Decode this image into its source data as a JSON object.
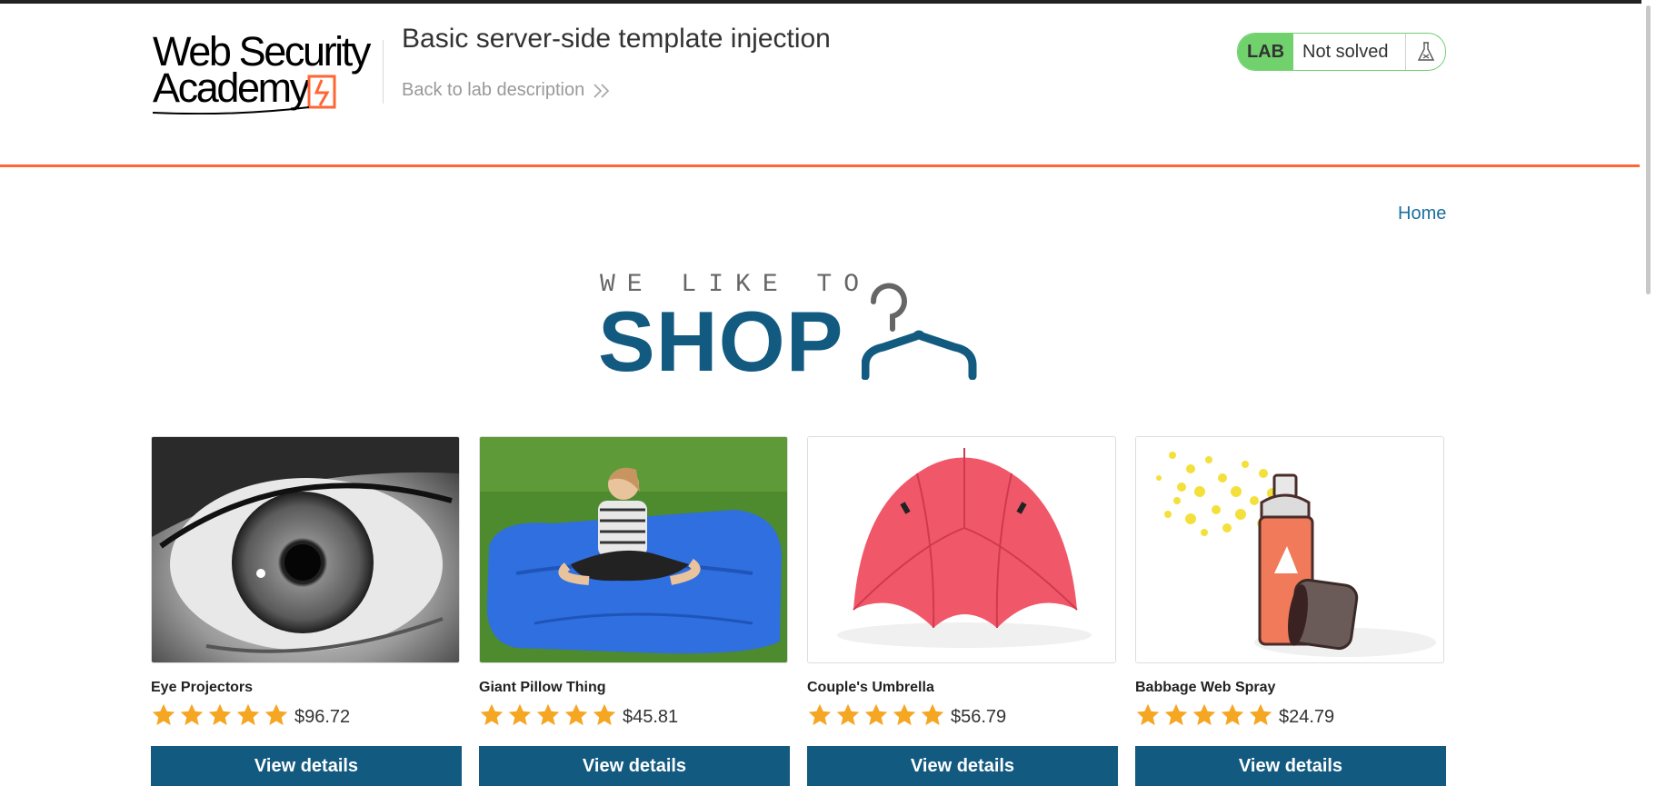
{
  "header": {
    "logo_line1": "Web Security",
    "logo_line2": "Academy",
    "lab_title": "Basic server-side template injection",
    "back_link": "Back to lab description",
    "lab_badge": "LAB",
    "lab_status": "Not solved",
    "colors": {
      "accent": "#ff6633",
      "status_green": "#70d16d"
    }
  },
  "nav": {
    "home": "Home"
  },
  "hero": {
    "tagline": "WE LIKE TO",
    "title": "SHOP",
    "icon": "hanger-icon"
  },
  "products": [
    {
      "name": "Eye Projectors",
      "rating": 5,
      "price": "$96.72",
      "button": "View details",
      "image": "eye-closeup-image"
    },
    {
      "name": "Giant Pillow Thing",
      "rating": 5,
      "price": "$45.81",
      "button": "View details",
      "image": "giant-pillow-image"
    },
    {
      "name": "Couple's Umbrella",
      "rating": 5,
      "price": "$56.79",
      "button": "View details",
      "image": "red-umbrella-image"
    },
    {
      "name": "Babbage Web Spray",
      "rating": 5,
      "price": "$24.79",
      "button": "View details",
      "image": "spray-can-image"
    }
  ],
  "theme": {
    "primary": "#135a80",
    "link": "#1a6fa0",
    "star": "#f5a623"
  }
}
